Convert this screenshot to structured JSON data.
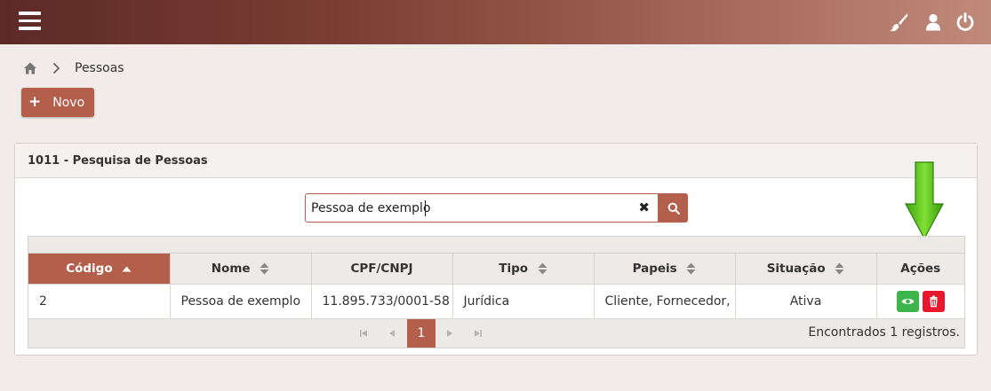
{
  "topbar": {
    "icons": [
      "menu-icon",
      "paint-brush-icon",
      "user-icon",
      "power-icon"
    ],
    "gradient_colors": [
      "#5e2a26",
      "#c08a7a"
    ]
  },
  "breadcrumb": {
    "home_icon": "home-icon",
    "separator_icon": "chevron-right-icon",
    "current": "Pessoas"
  },
  "actions": {
    "new_label": "Novo",
    "new_icon": "plus-icon"
  },
  "panel": {
    "title": "1011 - Pesquisa de Pessoas",
    "search": {
      "value": "Pessoa de exemplo",
      "clear_icon": "clear-icon",
      "button_icon": "search-icon"
    }
  },
  "table": {
    "columns": [
      {
        "label": "Código",
        "sort": "asc"
      },
      {
        "label": "Nome",
        "sort": "both"
      },
      {
        "label": "CPF/CNPJ",
        "sort": "none"
      },
      {
        "label": "Tipo",
        "sort": "both"
      },
      {
        "label": "Papeis",
        "sort": "both"
      },
      {
        "label": "Situação",
        "sort": "both"
      },
      {
        "label": "Ações",
        "sort": "none"
      }
    ],
    "rows": [
      {
        "codigo": "2",
        "nome": "Pessoa de exemplo",
        "cpf_cnpj": "11.895.733/0001-58",
        "tipo": "Jurídica",
        "papeis": "Cliente, Fornecedor,",
        "situacao": "Ativa",
        "actions": [
          "view-icon",
          "trash-icon"
        ]
      }
    ]
  },
  "pagination": {
    "current_page": "1",
    "records_text": "Encontrados 1 registros."
  },
  "annotation": {
    "icon": "green-arrow-down-icon"
  },
  "colors": {
    "accent": "#b45f4c",
    "view": "#3cb54a",
    "delete": "#e8192c",
    "arrow": "#5cc41c"
  }
}
